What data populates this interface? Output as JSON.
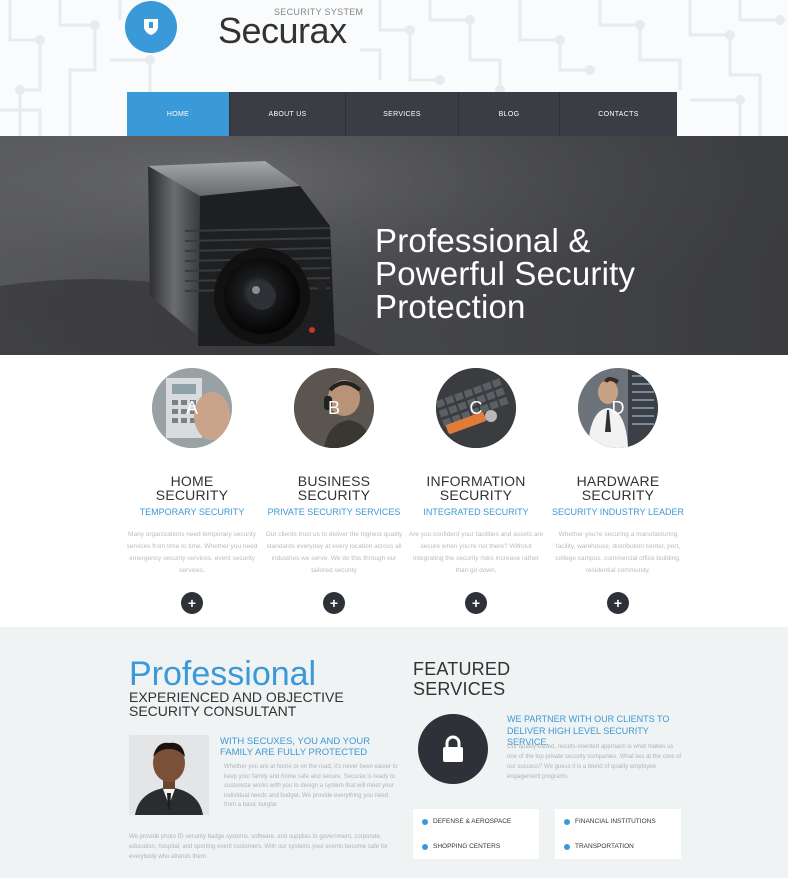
{
  "brand": {
    "tagline": "SECURITY SYSTEM",
    "name": "Securax",
    "logo_icon": "shield-icon",
    "accent": "#3a99d8",
    "dark": "#3a3d44"
  },
  "nav": {
    "items": [
      {
        "label": "HOME",
        "active": true
      },
      {
        "label": "ABOUT US",
        "active": false
      },
      {
        "label": "SERVICES",
        "active": false
      },
      {
        "label": "BLOG",
        "active": false
      },
      {
        "label": "CONTACTS",
        "active": false
      }
    ]
  },
  "hero": {
    "line1": "Professional &",
    "line2": "Powerful Security",
    "line3": "Protection"
  },
  "features": [
    {
      "letter": "A",
      "title1": "HOME",
      "title2": "SECURITY",
      "subtitle": "TEMPORARY SECURITY",
      "desc": "Many organizations need temporary security services from time to time. Whether you need emergency security services, event security services,",
      "button": "+"
    },
    {
      "letter": "B",
      "title1": "BUSINESS",
      "title2": "SECURITY",
      "subtitle": "PRIVATE SECURITY SERVICES",
      "desc": "Our clients trust us to deliver the highest quality standards everyday at every location across all industries we serve. We do this through our tailored security",
      "button": "+"
    },
    {
      "letter": "C",
      "title1": "INFORMATION",
      "title2": "SECURITY",
      "subtitle": "INTEGRATED SECURITY",
      "desc": "Are you confident your facilities and assets are secure when you're not there? Without integrating the security risks increase rather than go down.",
      "button": "+"
    },
    {
      "letter": "D",
      "title1": "HARDWARE",
      "title2": "SECURITY",
      "subtitle": "SECURITY INDUSTRY LEADER",
      "desc": "Whether you're securing a manufacturing facility, warehouse, distribution center, port, college campus, commercial office building, residential community,",
      "button": "+"
    }
  ],
  "professional": {
    "title": "Professional",
    "subtitle": "EXPERIENCED AND OBJECTIVE SECURITY CONSULTANT",
    "person_heading": "WITH SECUXES, YOU AND YOUR FAMILY ARE FULLY PROTECTED",
    "person_text": "Whether you are at home or on the road, it's never been easier to keep your family and home safe and secure. Securax is ready to customize works with you to design a system that will meet your individual needs and budget. We provide everything you need from a basic burglar",
    "bottom_text": "We provide photo ID security badge systems, software, and supplies to government, corporate, education, hospital, and sporting event customers. With our systems your events become safe for everybody who attends them."
  },
  "featured": {
    "title1": "FEATURED",
    "title2": "SERVICES",
    "icon": "lock-icon",
    "heading": "WE PARTNER WITH OUR CLIENTS TO DELIVER HIGH LEVEL SECURITY SERVICE.",
    "text": "Our quality-based, results-oriented approach is what makes us one of the top private security companies. What lies at the core of our success? We guess it is a blend of quality employee engagement programs.",
    "services": [
      "DEFENSE & AEROSPACE",
      "FINANCIAL INSTITUTIONS",
      "SHOPPING CENTERS",
      "TRANSPORTATION"
    ]
  }
}
